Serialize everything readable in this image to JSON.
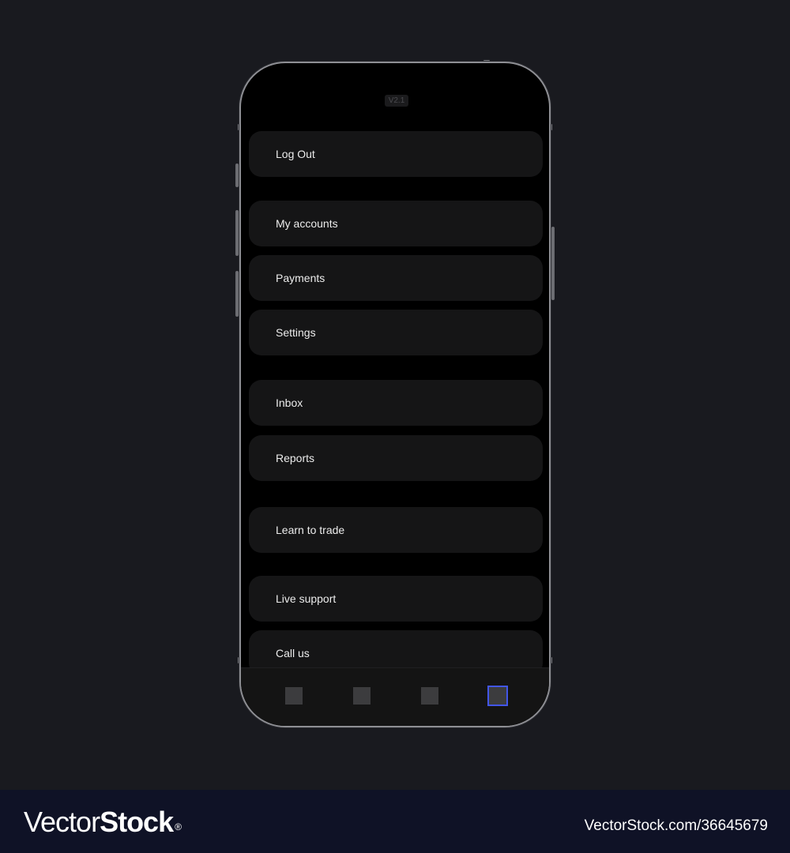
{
  "app": {
    "version": "V2.1"
  },
  "menu": {
    "items": [
      {
        "label": "Log Out"
      },
      {
        "label": "My accounts"
      },
      {
        "label": "Payments"
      },
      {
        "label": "Settings"
      },
      {
        "label": "Inbox"
      },
      {
        "label": "Reports"
      },
      {
        "label": "Learn to trade"
      },
      {
        "label": "Live support"
      },
      {
        "label": "Call us"
      }
    ]
  },
  "tabbar": {
    "tabs": [
      {
        "icon": "tab-1-icon",
        "active": false
      },
      {
        "icon": "tab-2-icon",
        "active": false
      },
      {
        "icon": "tab-3-icon",
        "active": false
      },
      {
        "icon": "tab-4-icon",
        "active": true
      }
    ],
    "accent_color": "#4256e8"
  },
  "watermark": {
    "logo_light": "Vector",
    "logo_bold": "Stock",
    "logo_mark": "®",
    "credit": "VectorStock.com/36645679"
  }
}
